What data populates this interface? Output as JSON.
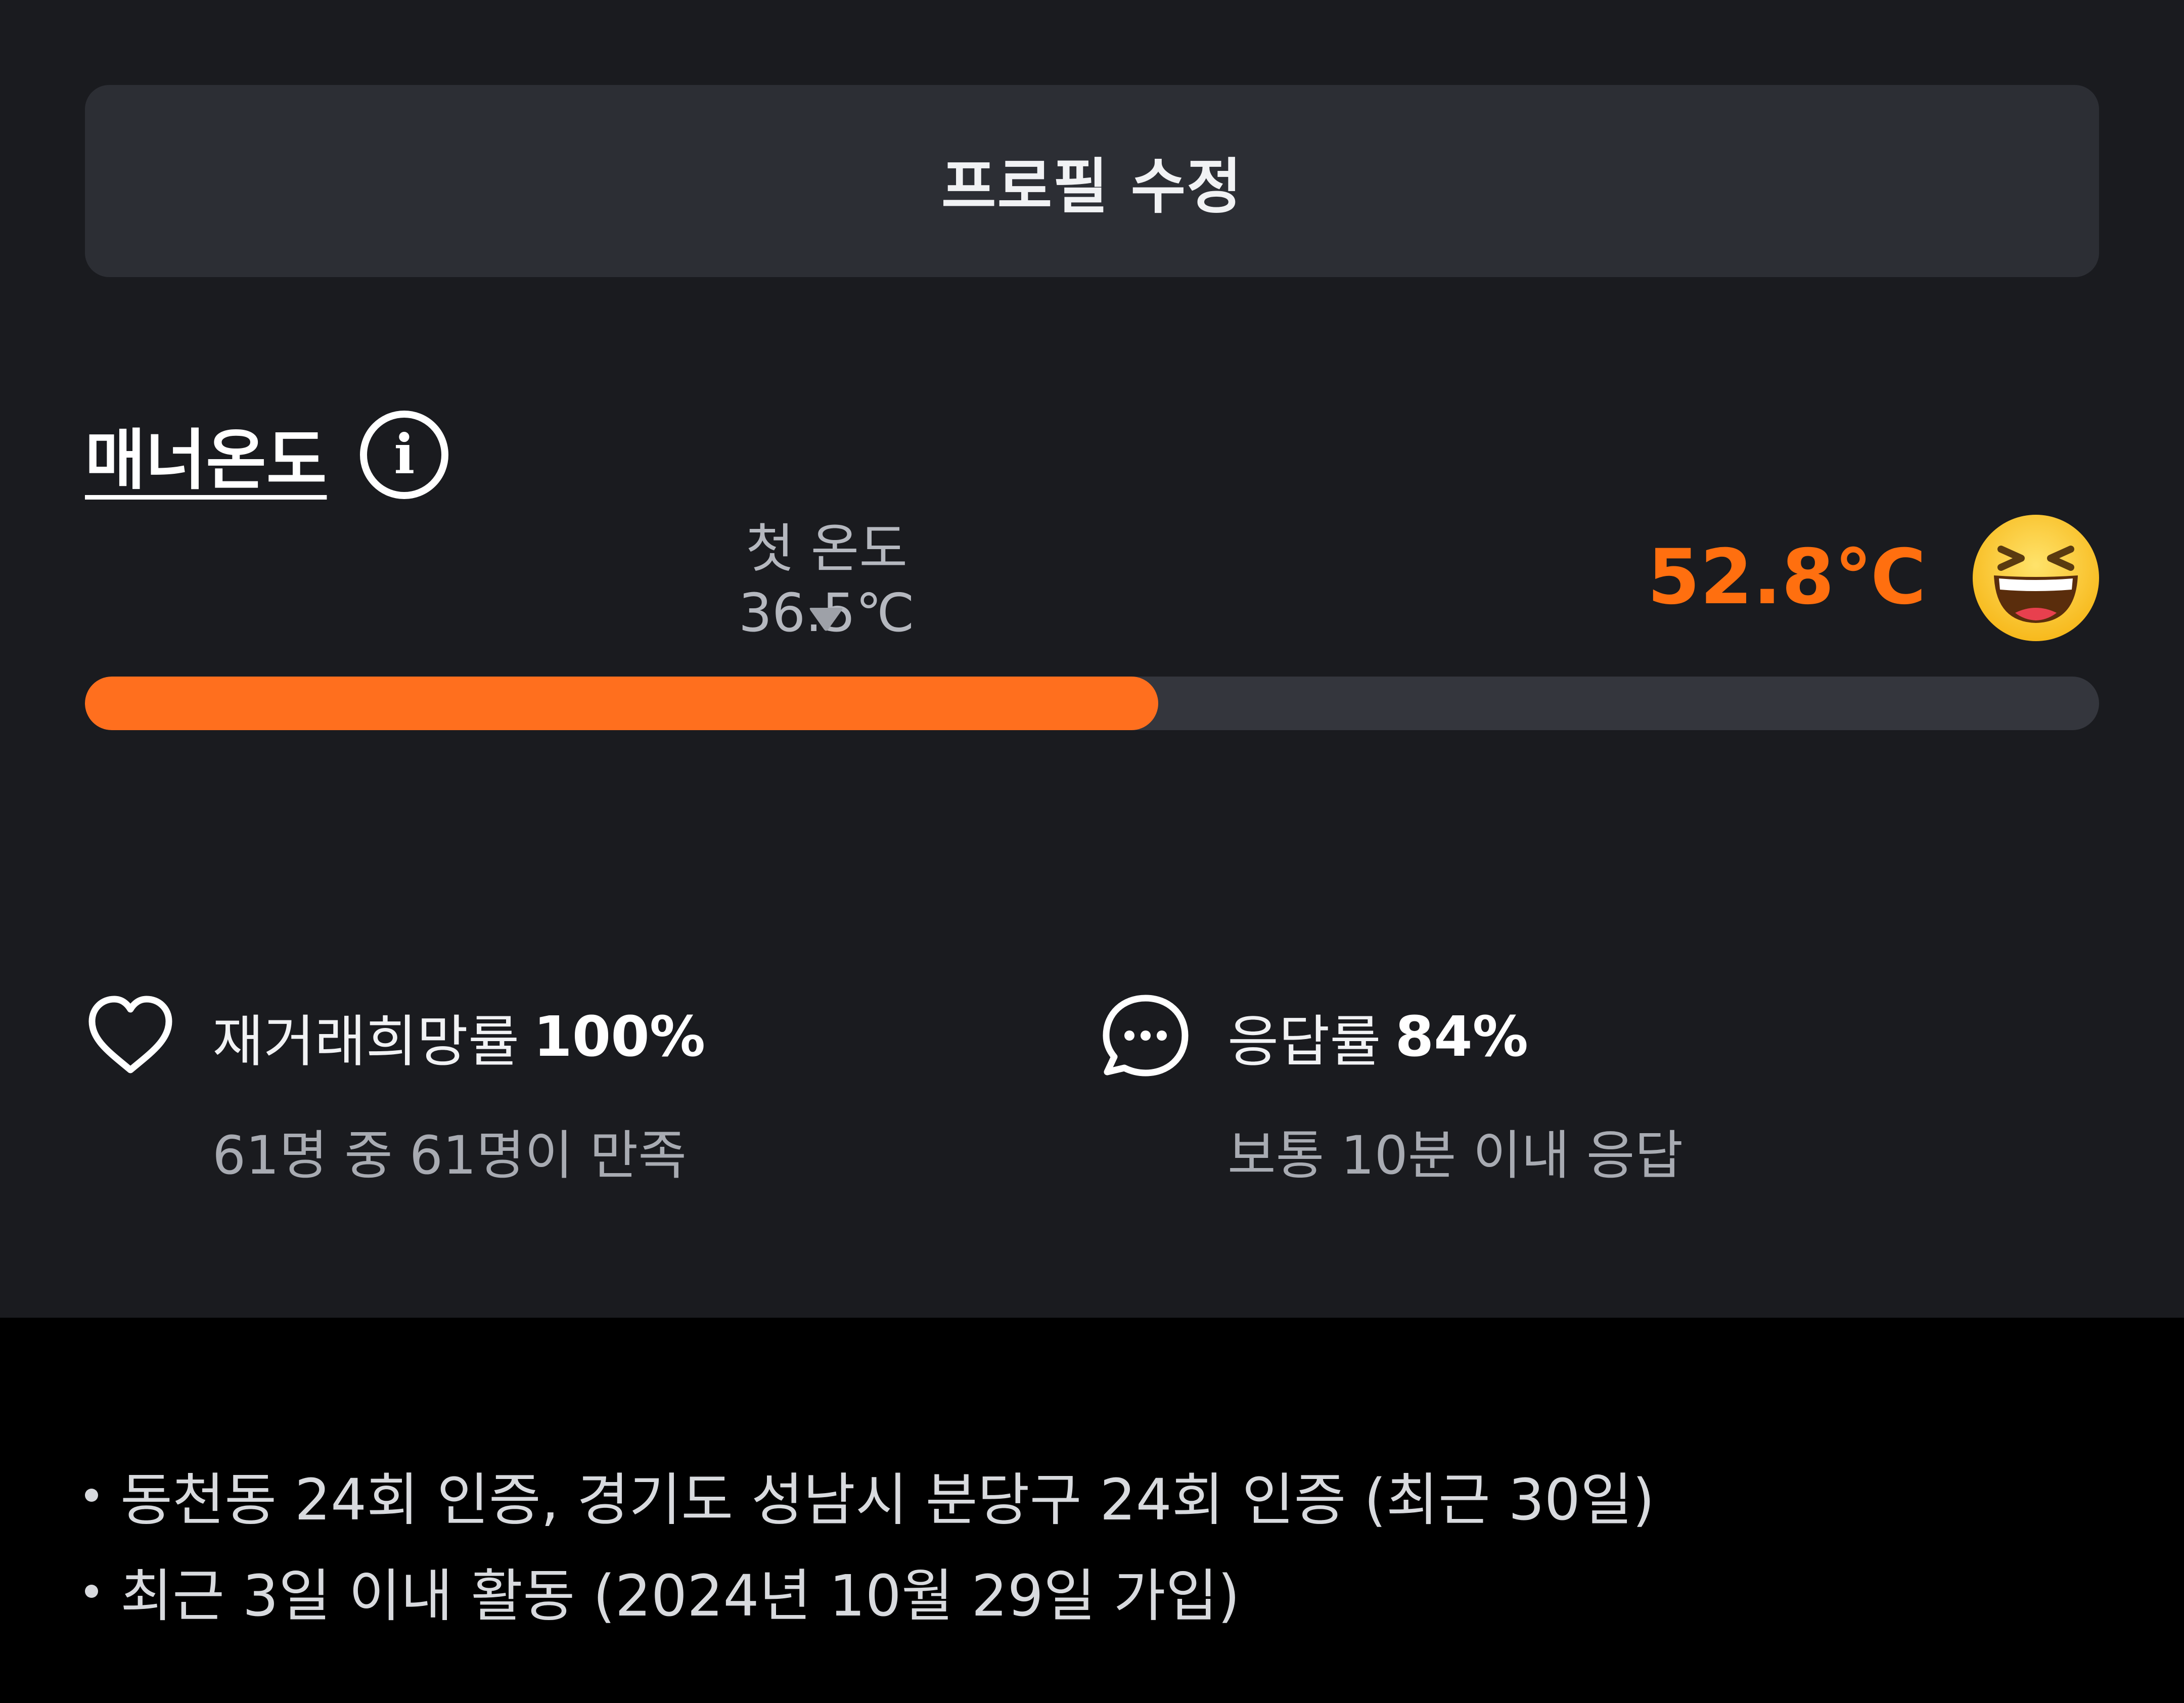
{
  "profile": {
    "edit_button_label": "프로필 수정"
  },
  "manner": {
    "title": "매너온도",
    "first_temperature_label": "첫 온도 36.5℃",
    "first_temperature_value": 36.5,
    "current_temperature": "52.8℃",
    "current_temperature_value": 52.8,
    "bar_fill_percent": 53.3,
    "accent_color": "#ff6f0f",
    "emoji": "grinning-squinting-face"
  },
  "stats": {
    "rehire": {
      "icon": "heart-icon",
      "label": "재거래희망률",
      "value": "100%",
      "detail": "61명 중 61명이 만족"
    },
    "response": {
      "icon": "chat-bubble-icon",
      "label": "응답률",
      "value": "84%",
      "detail": "보통 10분 이내 응답"
    }
  },
  "activity": {
    "lines": [
      "동천동 24회 인증, 경기도 성남시 분당구 24회 인증 (최근 30일)",
      "최근 3일 이내 활동 (2024년 10월 29일 가입)"
    ]
  }
}
